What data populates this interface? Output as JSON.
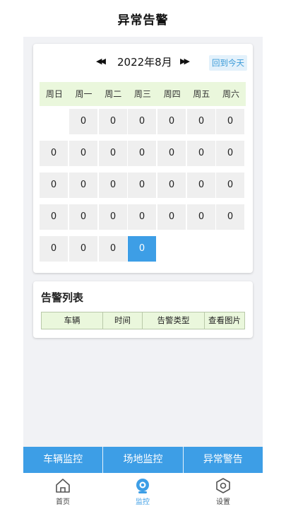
{
  "header": {
    "title": "异常告警"
  },
  "calendar": {
    "prev_icon": "double-left-arrow",
    "next_icon": "double-right-arrow",
    "month_label": "2022年8月",
    "today_button": "回到今天",
    "weekdays": [
      "周日",
      "周一",
      "周二",
      "周三",
      "周四",
      "周五",
      "周六"
    ],
    "days": [
      [
        "",
        "0",
        "0",
        "0",
        "0",
        "0",
        "0"
      ],
      [
        "0",
        "0",
        "0",
        "0",
        "0",
        "0",
        "0"
      ],
      [
        "0",
        "0",
        "0",
        "0",
        "0",
        "0",
        "0"
      ],
      [
        "0",
        "0",
        "0",
        "0",
        "0",
        "0",
        "0"
      ],
      [
        "0",
        "0",
        "0",
        "0",
        "",
        "",
        ""
      ]
    ],
    "today_index": {
      "week": 4,
      "day": 3
    },
    "highlight_color": "#3d9ee6",
    "weekday_bg": "#eaf7dc"
  },
  "alarm_list": {
    "title": "告警列表",
    "columns": [
      "车辆",
      "时间",
      "告警类型",
      "查看图片"
    ]
  },
  "tabs": [
    "车辆监控",
    "场地监控",
    "异常警告"
  ],
  "bottom_nav": [
    {
      "label": "首页",
      "icon": "home-icon",
      "active": false
    },
    {
      "label": "监控",
      "icon": "camera-icon",
      "active": true
    },
    {
      "label": "设置",
      "icon": "settings-hexagon-icon",
      "active": false
    }
  ],
  "colors": {
    "accent": "#3d9ee6",
    "today_button_bg": "#e3f1fb"
  }
}
